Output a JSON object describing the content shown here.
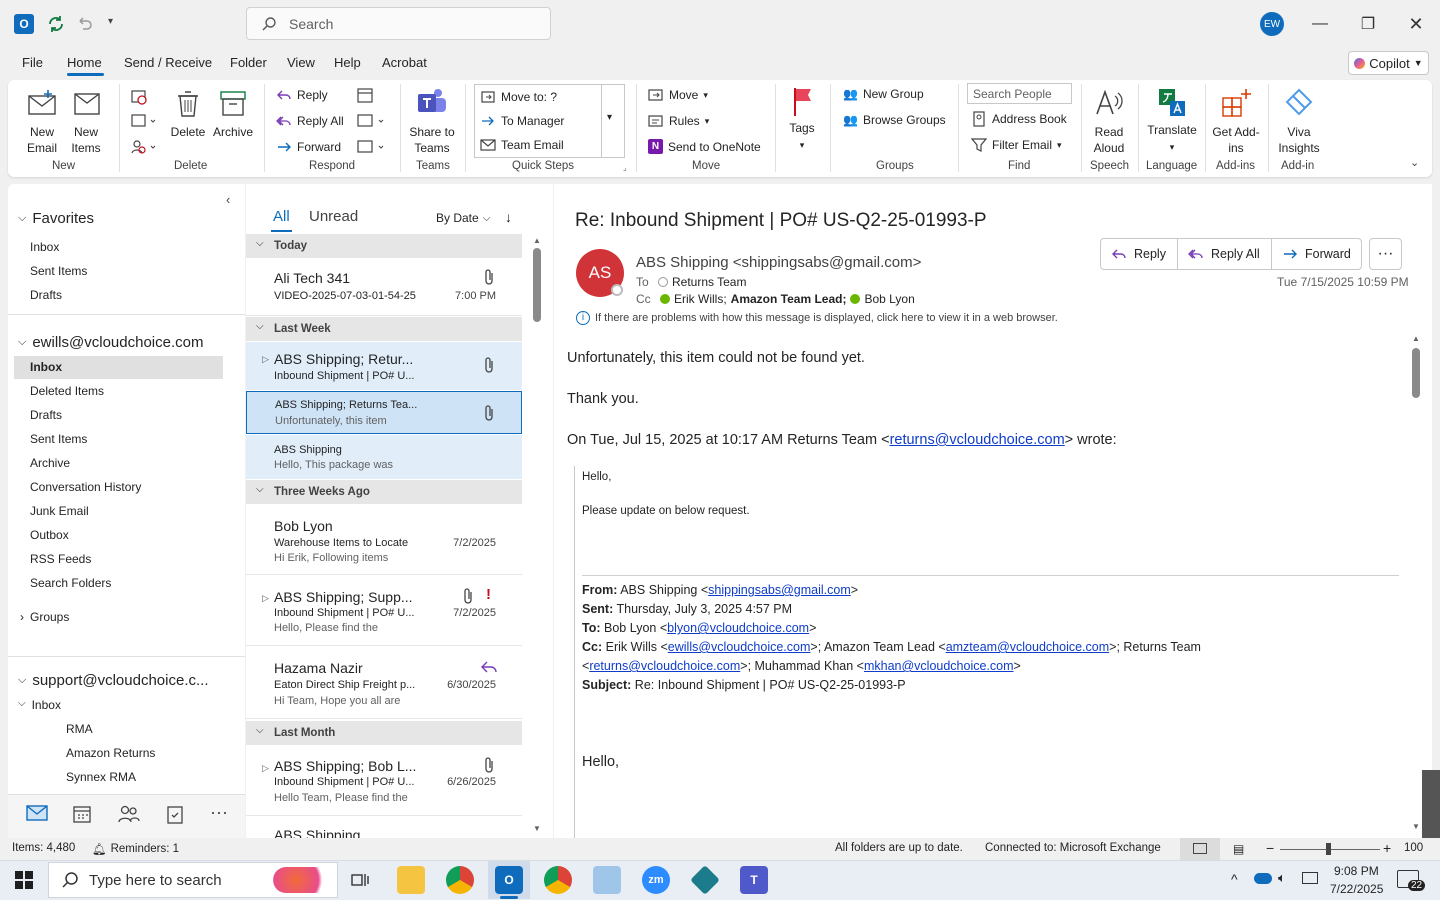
{
  "titlebar": {
    "search_placeholder": "Search",
    "avatar_initials": "EW"
  },
  "menu": [
    "File",
    "Home",
    "Send / Receive",
    "Folder",
    "View",
    "Help",
    "Acrobat"
  ],
  "copilot": "Copilot",
  "ribbon": {
    "new_email": "New Email",
    "new_items": "New Items",
    "delete": "Delete",
    "archive": "Archive",
    "reply": "Reply",
    "reply_all": "Reply All",
    "forward": "Forward",
    "share_to_teams": "Share to Teams",
    "qs_move_to": "Move to: ?",
    "qs_to_manager": "To Manager",
    "qs_team_email": "Team Email",
    "move": "Move",
    "rules": "Rules",
    "send_onenote": "Send to OneNote",
    "tags": "Tags",
    "new_group": "New Group",
    "browse_groups": "Browse Groups",
    "search_people": "Search People",
    "address_book": "Address Book",
    "filter_email": "Filter Email",
    "read_aloud": "Read Aloud",
    "translate": "Translate",
    "get_addins": "Get Add-ins",
    "viva": "Viva Insights",
    "groups": [
      "New",
      "Delete",
      "Respond",
      "Teams",
      "Quick Steps",
      "Move",
      "Groups",
      "Find",
      "Speech",
      "Language",
      "Add-ins",
      "Add-in"
    ]
  },
  "folders": {
    "favorites": "Favorites",
    "fav_items": [
      "Inbox",
      "Sent Items",
      "Drafts"
    ],
    "account1": "ewills@vcloudchoice.com",
    "acct_items": [
      "Inbox",
      "Deleted Items",
      "Drafts",
      "Sent Items",
      "Archive",
      "Conversation History",
      "Junk Email",
      "Outbox",
      "RSS Feeds",
      "Search Folders"
    ],
    "groups": "Groups",
    "account2": "support@vcloudchoice.c...",
    "acct2_inbox": "Inbox",
    "acct2_items": [
      "RMA",
      "Amazon Returns",
      "Synnex RMA"
    ]
  },
  "list": {
    "tab_all": "All",
    "tab_unread": "Unread",
    "sort": "By Date",
    "sections": [
      "Today",
      "Last Week",
      "Three Weeks Ago",
      "Last Month"
    ],
    "m1": {
      "sender": "Ali Tech 341",
      "subject": "VIDEO-2025-07-03-01-54-25",
      "date": "7:00 PM"
    },
    "m2": {
      "sender": "ABS Shipping;  Retur...",
      "subject": "Inbound Shipment | PO# U..."
    },
    "m3": {
      "sender": "ABS Shipping;  Returns Tea...",
      "preview": "Unfortunately, this item"
    },
    "m4": {
      "sender": "ABS Shipping",
      "preview": "Hello,  This package was"
    },
    "m5": {
      "sender": "Bob Lyon",
      "subject": "Warehouse Items to Locate",
      "preview": "Hi Erik,  Following items",
      "date": "7/2/2025"
    },
    "m6": {
      "sender": "ABS Shipping;  Supp...",
      "subject": "Inbound Shipment | PO# U...",
      "preview": "Hello,  Please find the",
      "date": "7/2/2025",
      "flag": "!"
    },
    "m7": {
      "sender": "Hazama Nazir",
      "subject": "Eaton Direct Ship Freight p...",
      "preview": "Hi Team,  Hope you all are",
      "date": "6/30/2025"
    },
    "m8": {
      "sender": "ABS Shipping;  Bob L...",
      "subject": "Inbound Shipment | PO# U...",
      "preview": "Hello Team,  Please find the",
      "date": "6/26/2025"
    },
    "m9": {
      "sender": "ABS Shipping"
    }
  },
  "reading": {
    "subject": "Re: Inbound Shipment | PO# US-Q2-25-01993-P",
    "avatar": "AS",
    "from": "ABS Shipping <shippingsabs@gmail.com>",
    "to_label": "To",
    "to": "Returns Team",
    "cc_label": "Cc",
    "cc1": "Erik Wills;",
    "cc2": "Amazon Team Lead;",
    "cc3": "Bob Lyon",
    "reply": "Reply",
    "reply_all": "Reply All",
    "forward": "Forward",
    "datetime": "Tue 7/15/2025 10:59 PM",
    "info": "If there are problems with how this message is displayed, click here to view it in a web browser.",
    "body1": "Unfortunately, this item could not be found yet.",
    "body2": "Thank you.",
    "wrote_pre": "On Tue, Jul 15, 2025 at 10:17 AM Returns Team <",
    "wrote_link": "returns@vcloudchoice.com",
    "wrote_post": "> wrote:",
    "q_hello": "Hello,",
    "q_update": "Please update on below request.",
    "from_label": "From:",
    "from_val": "ABS Shipping <",
    "from_link": "shippingsabs@gmail.com",
    "from_end": ">",
    "sent_label": "Sent:",
    "sent_val": "Thursday, July 3, 2025 4:57 PM",
    "to2_label": "To:",
    "to2_val": "Bob Lyon <",
    "to2_link": "blyon@vcloudchoice.com",
    "to2_end": ">",
    "cc2_label": "Cc:",
    "cc2_a": "Erik Wills <",
    "cc2_l1": "ewills@vcloudchoice.com",
    "cc2_b": ">; Amazon Team Lead <",
    "cc2_l2": "amzteam@vcloudchoice.com",
    "cc2_c": ">; Returns Team",
    "cc2_d": "<",
    "cc2_l3": "returns@vcloudchoice.com",
    "cc2_e": ">; Muhammad Khan <",
    "cc2_l4": "mkhan@vcloudchoice.com",
    "cc2_f": ">",
    "subj_label": "Subject:",
    "subj_val": "Re: Inbound Shipment | PO# US-Q2-25-01993-P",
    "q_hello2": "Hello,"
  },
  "status": {
    "items": "Items: 4,480",
    "reminders": "Reminders: 1",
    "folders": "All folders are up to date.",
    "connected": "Connected to: Microsoft Exchange",
    "zoom": "100"
  },
  "taskbar": {
    "search": "Type here to search",
    "time": "9:08 PM",
    "date": "7/22/2025",
    "notif": "22"
  }
}
